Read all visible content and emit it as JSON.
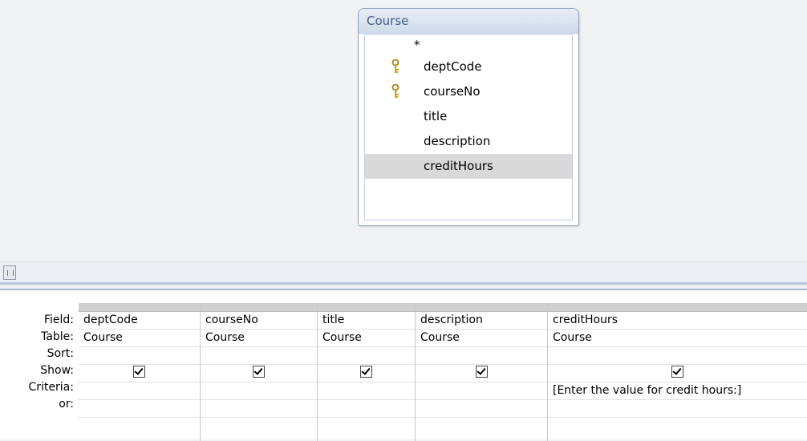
{
  "table_box": {
    "title": "Course",
    "fields": [
      {
        "label": "*",
        "primary_key": false
      },
      {
        "label": "deptCode",
        "primary_key": true
      },
      {
        "label": "courseNo",
        "primary_key": true
      },
      {
        "label": "title",
        "primary_key": false
      },
      {
        "label": "description",
        "primary_key": false
      },
      {
        "label": "creditHours",
        "primary_key": false,
        "selected": true
      }
    ]
  },
  "grid": {
    "row_labels": [
      "Field:",
      "Table:",
      "Sort:",
      "Show:",
      "Criteria:",
      "or:"
    ],
    "columns": [
      {
        "field": "deptCode",
        "table": "Course",
        "sort": "",
        "show": true,
        "criteria": ""
      },
      {
        "field": "courseNo",
        "table": "Course",
        "sort": "",
        "show": true,
        "criteria": ""
      },
      {
        "field": "title",
        "table": "Course",
        "sort": "",
        "show": true,
        "criteria": ""
      },
      {
        "field": "description",
        "table": "Course",
        "sort": "",
        "show": true,
        "criteria": ""
      },
      {
        "field": "creditHours",
        "table": "Course",
        "sort": "",
        "show": true,
        "criteria": "[Enter the value for credit hours:]"
      }
    ]
  },
  "colors": {
    "key_icon": "#c9a227",
    "header_text": "#3f5b82"
  }
}
